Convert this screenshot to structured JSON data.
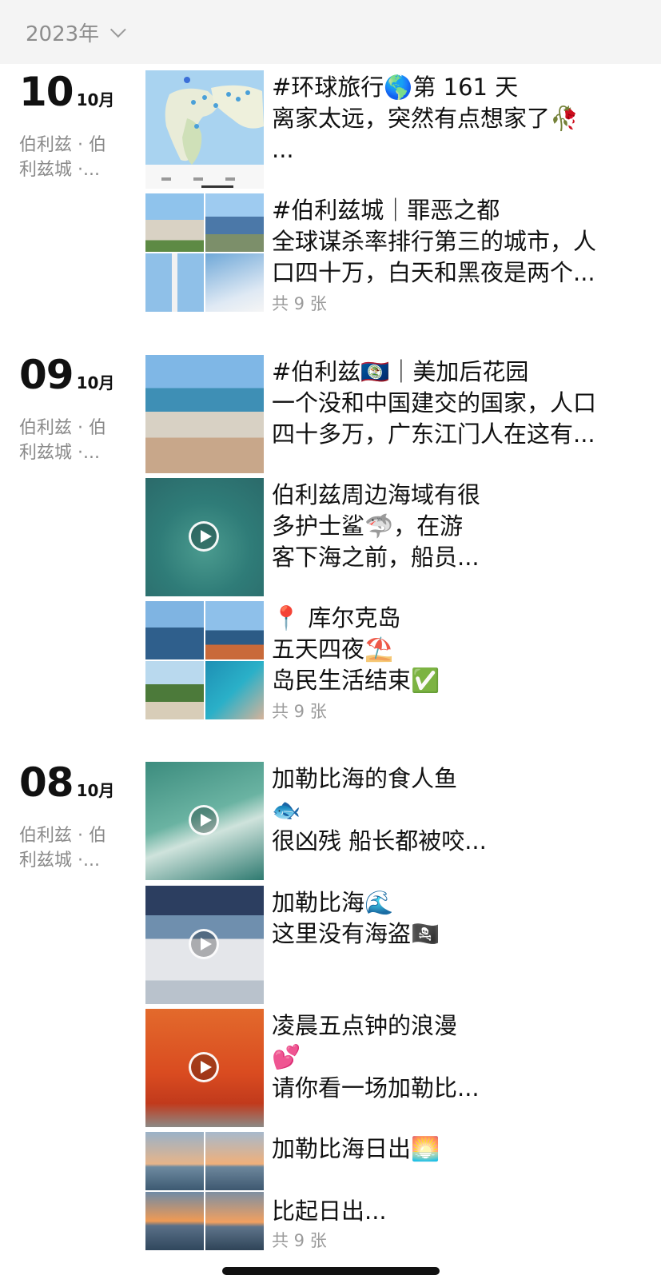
{
  "header": {
    "year": "2023年"
  },
  "days": [
    {
      "day": "10",
      "month": "10月",
      "location": "伯利兹 · 伯利兹城 ·...",
      "posts": [
        {
          "lines": [
            "#环球旅行🌎第 161 天",
            "离家太远，突然有点想家了🥀",
            "..."
          ],
          "type": "map"
        },
        {
          "lines": [
            "#伯利兹城｜罪恶之都",
            "全球谋杀率排行第三的城市，人",
            "口四十万，白天和黑夜是两个..."
          ],
          "count": "共 9 张",
          "type": "grid"
        }
      ]
    },
    {
      "day": "09",
      "month": "10月",
      "location": "伯利兹 · 伯利兹城 ·...",
      "posts": [
        {
          "lines": [
            "#伯利兹🇧🇿｜美加后花园",
            "一个没和中国建交的国家，人口",
            "四十多万，广东江门人在这有..."
          ],
          "type": "photo"
        },
        {
          "lines": [
            "伯利兹周边海域有很",
            "多护士鲨🦈，在游",
            "客下海之前，船员..."
          ],
          "type": "video"
        },
        {
          "lines": [
            "📍 库尔克岛",
            "五天四夜⛱️",
            "岛民生活结束✅"
          ],
          "count": "共 9 张",
          "type": "grid"
        }
      ]
    },
    {
      "day": "08",
      "month": "10月",
      "location": "伯利兹 · 伯利兹城 ·...",
      "posts": [
        {
          "lines": [
            "加勒比海的食人鱼",
            "🐟",
            "很凶残 船长都被咬..."
          ],
          "type": "video"
        },
        {
          "lines": [
            "加勒比海🌊",
            "这里没有海盗🏴‍☠️"
          ],
          "type": "video"
        },
        {
          "lines": [
            "凌晨五点钟的浪漫",
            "💕",
            "请你看一场加勒比..."
          ],
          "type": "video"
        },
        {
          "lines": [
            "加勒比海日出🌅",
            "",
            "比起日出..."
          ],
          "count": "共 9 张",
          "type": "grid"
        }
      ]
    }
  ]
}
